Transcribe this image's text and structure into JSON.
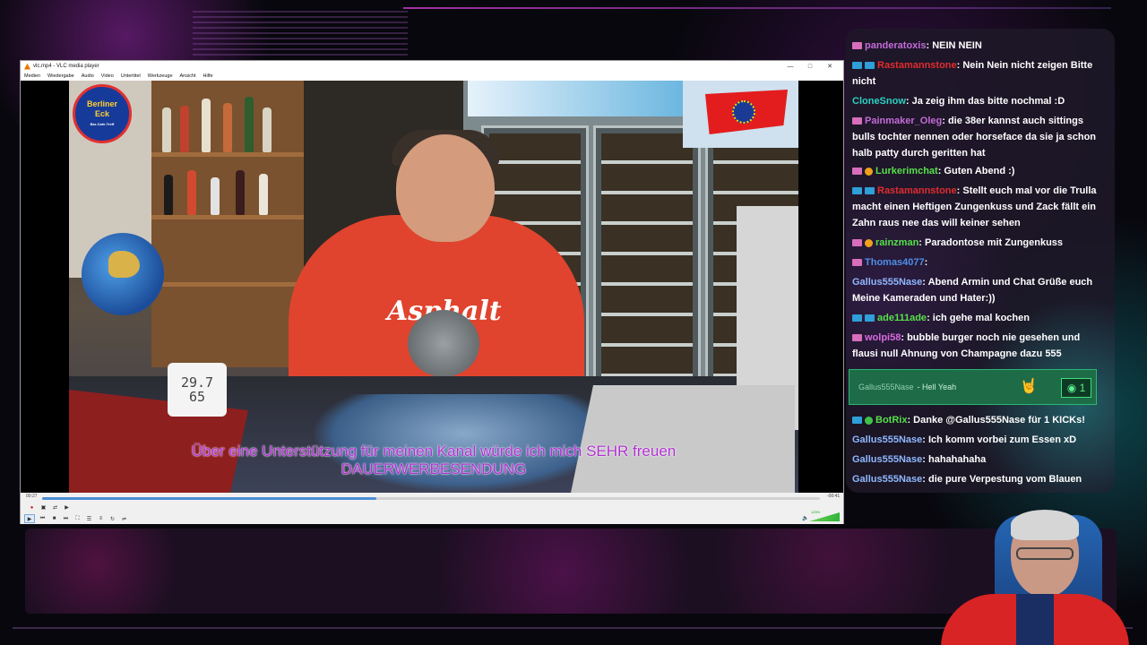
{
  "vlc": {
    "window_title": "vlc.mp4 - VLC media player",
    "menu": [
      "Medien",
      "Wiedergabe",
      "Audio",
      "Video",
      "Untertitel",
      "Werkzeuge",
      "Ansicht",
      "Hilfe"
    ],
    "time_elapsed": "00:27",
    "time_remaining": "-00:41",
    "progress": 0.43,
    "volume_percent": "125%",
    "subtitles": [
      "Über eine Unterstützung für meinen Kanal würde ich mich SEHR freuen",
      "DAUERWERBESENDUNG"
    ],
    "overlay_logo": {
      "line1": "Berliner",
      "line2": "Eck",
      "small": "Bar-Cafe-Treff"
    },
    "thermometer": {
      "line1": "29.7",
      "line2": "65"
    },
    "shirt_text": "Asphalt"
  },
  "chat": {
    "messages": [
      {
        "badges": [
          "pink"
        ],
        "user": "panderatoxis",
        "user_color": "#c46bd8",
        "text": ": NEIN NEIN"
      },
      {
        "badges": [
          "blue",
          "blue"
        ],
        "user": "Rastamannstone",
        "user_color": "#e02d2d",
        "text": ": Nein Nein nicht zeigen Bitte nicht"
      },
      {
        "badges": [],
        "user": "CloneSnow",
        "user_color": "#2fd0c0",
        "text": ": Ja zeig ihm das bitte nochmal :D"
      },
      {
        "badges": [
          "pink"
        ],
        "user": "Painmaker_Oleg",
        "user_color": "#c46bd8",
        "text": ": die 38er kannst auch sittings bulls tochter nennen oder horseface da sie ja schon halb patty durch geritten hat"
      },
      {
        "badges": [
          "pink",
          "orange"
        ],
        "user": "Lurkerimchat",
        "user_color": "#56e04a",
        "text": ": Guten Abend :)"
      },
      {
        "badges": [
          "blue",
          "blue"
        ],
        "user": "Rastamannstone",
        "user_color": "#e02d2d",
        "text": ": Stellt euch mal vor die Trulla macht einen Heftigen Zungenkuss und Zack fällt ein Zahn raus nee das will keiner sehen"
      },
      {
        "badges": [
          "pink",
          "orange"
        ],
        "user": "rainzman",
        "user_color": "#56e04a",
        "text": ": Paradontose mit Zungenkuss"
      },
      {
        "badges": [
          "pink"
        ],
        "user": "Thomas4077",
        "user_color": "#4d8fe8",
        "text": ":"
      },
      {
        "badges": [],
        "user": "Gallus555Nase",
        "user_color": "#8fb8ff",
        "text": ": Abend Armin und Chat Grüße euch Meine Kameraden und Hater:))"
      },
      {
        "badges": [
          "blue",
          "blue"
        ],
        "user": "ade111ade",
        "user_color": "#56e04a",
        "text": ": ich gehe mal kochen"
      },
      {
        "badges": [
          "pink"
        ],
        "user": "wolpi58",
        "user_color": "#d96ae0",
        "text": ": bubble burger noch nie gesehen und flausi null Ahnung von Champagne dazu 555"
      }
    ],
    "highlight": {
      "user": "Gallus555Nase",
      "text": "- Hell Yeah",
      "icon": "rock-hand-icon",
      "count": "1"
    },
    "messages_after": [
      {
        "badges": [
          "blue",
          "green"
        ],
        "user": "BotRix",
        "user_color": "#56e04a",
        "text": ": Danke @Gallus555Nase für 1 KICKs!"
      },
      {
        "badges": [],
        "user": "Gallus555Nase",
        "user_color": "#8fb8ff",
        "text": ": Ich komm vorbei zum Essen xD"
      },
      {
        "badges": [],
        "user": "Gallus555Nase",
        "user_color": "#8fb8ff",
        "text": ": hahahahaha"
      },
      {
        "badges": [],
        "user": "Gallus555Nase",
        "user_color": "#8fb8ff",
        "text": ": die pure Verpestung vom Blauen"
      }
    ]
  }
}
